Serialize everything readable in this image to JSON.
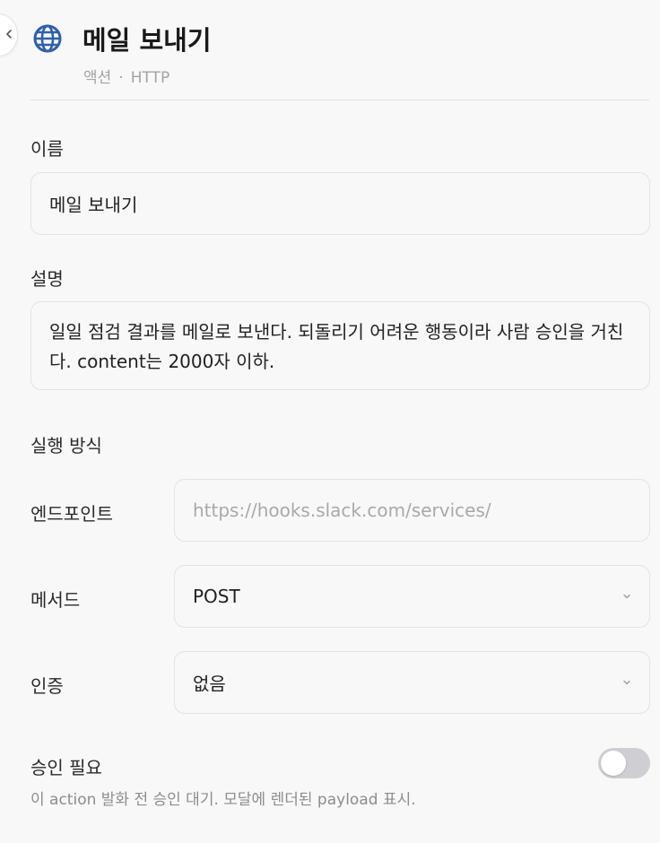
{
  "header": {
    "title": "메일 보내기",
    "subtitle_type": "액션",
    "subtitle_separator": "·",
    "subtitle_kind": "HTTP",
    "icon": "globe-icon",
    "icon_color": "#2f5fb0"
  },
  "form": {
    "name": {
      "label": "이름",
      "value": "메일 보내기"
    },
    "description": {
      "label": "설명",
      "value": "일일 점검 결과를 메일로 보낸다. 되돌리기 어려운 행동이라 사람 승인을 거친다. content는 2000자 이하."
    },
    "execution": {
      "section_label": "실행 방식",
      "endpoint": {
        "label": "엔드포인트",
        "value": "",
        "placeholder": "https://hooks.slack.com/services/"
      },
      "method": {
        "label": "메서드",
        "value": "POST"
      },
      "auth": {
        "label": "인증",
        "value": "없음"
      }
    },
    "approval": {
      "label": "승인 필요",
      "help": "이 action 발화 전 승인 대기. 모달에 렌더된 payload 표시.",
      "enabled": false
    }
  }
}
